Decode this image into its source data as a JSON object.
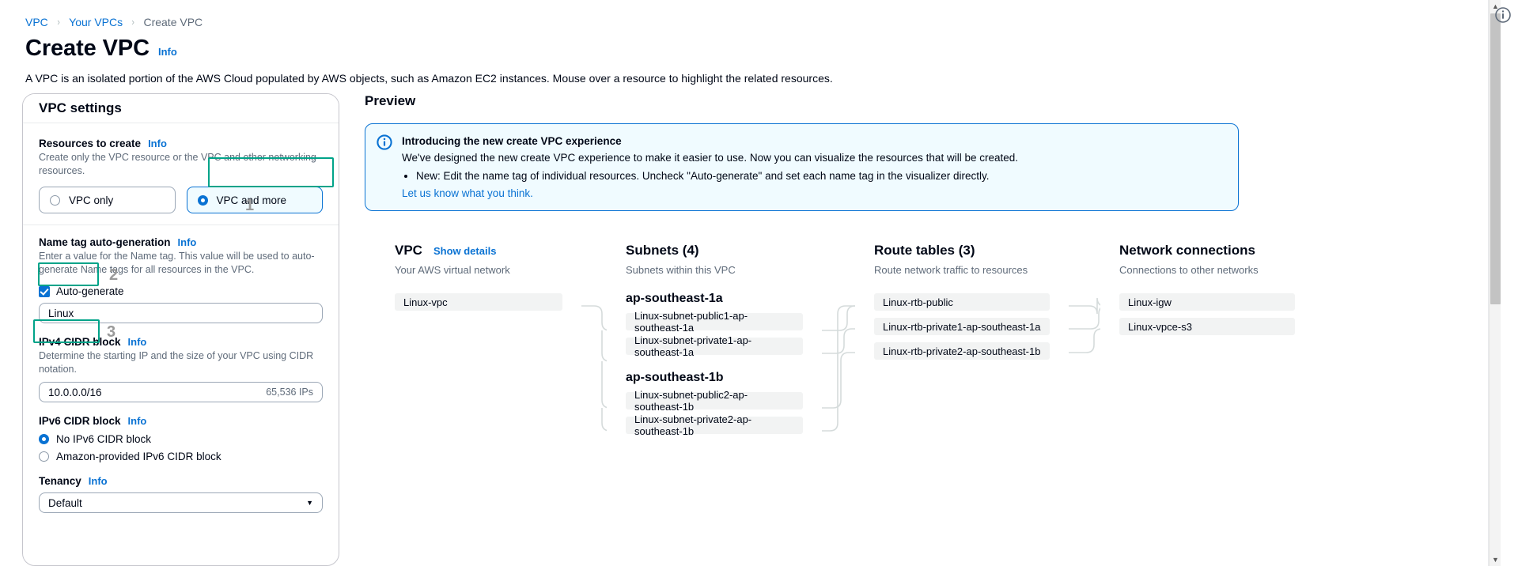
{
  "breadcrumb": {
    "items": [
      "VPC",
      "Your VPCs",
      "Create VPC"
    ],
    "separator": "›"
  },
  "header": {
    "title": "Create VPC",
    "info_label": "Info",
    "description": "A VPC is an isolated portion of the AWS Cloud populated by AWS objects, such as Amazon EC2 instances. Mouse over a resource to highlight the related resources."
  },
  "settings": {
    "card_title": "VPC settings",
    "resources_to_create": {
      "label": "Resources to create",
      "info_label": "Info",
      "description": "Create only the VPC resource or the VPC and other networking resources.",
      "options": [
        "VPC only",
        "VPC and more"
      ],
      "selected": "VPC and more",
      "annotation": "1"
    },
    "name_tag": {
      "label": "Name tag auto-generation",
      "info_label": "Info",
      "description": "Enter a value for the Name tag. This value will be used to auto-generate Name tags for all resources in the VPC.",
      "auto_generate_label": "Auto-generate",
      "auto_generate_checked": true,
      "value": "Linux",
      "annotation": "2"
    },
    "ipv4_cidr": {
      "label": "IPv4 CIDR block",
      "info_label": "Info",
      "description": "Determine the starting IP and the size of your VPC using CIDR notation.",
      "value": "10.0.0.0/16",
      "suffix": "65,536 IPs",
      "annotation": "3"
    },
    "ipv6_cidr": {
      "label": "IPv6 CIDR block",
      "info_label": "Info",
      "options": [
        "No IPv6 CIDR block",
        "Amazon-provided IPv6 CIDR block"
      ],
      "selected": "No IPv6 CIDR block"
    },
    "tenancy": {
      "label": "Tenancy",
      "info_label": "Info",
      "value": "Default",
      "caret": "▼"
    }
  },
  "preview": {
    "title": "Preview",
    "alert": {
      "icon": "info-circle-icon",
      "title": "Introducing the new create VPC experience",
      "body": "We've designed the new create VPC experience to make it easier to use. Now you can visualize the resources that will be created.",
      "bullets": [
        "New: Edit the name tag of individual resources. Uncheck \"Auto-generate\" and set each name tag in the visualizer directly."
      ],
      "link": "Let us know what you think."
    },
    "cards": [
      {
        "title": "VPC",
        "link": "Show details",
        "subtitle": "Your AWS virtual network",
        "items": [
          "Linux-vpc"
        ]
      },
      {
        "title": "Subnets (4)",
        "subtitle": "Subnets within this VPC",
        "groups": [
          {
            "az": "ap-southeast-1a",
            "items": [
              "Linux-subnet-public1-ap-southeast-1a",
              "Linux-subnet-private1-ap-southeast-1a"
            ]
          },
          {
            "az": "ap-southeast-1b",
            "items": [
              "Linux-subnet-public2-ap-southeast-1b",
              "Linux-subnet-private2-ap-southeast-1b"
            ]
          }
        ]
      },
      {
        "title": "Route tables (3)",
        "subtitle": "Route network traffic to resources",
        "items": [
          "Linux-rtb-public",
          "Linux-rtb-private1-ap-southeast-1a",
          "Linux-rtb-private2-ap-southeast-1b"
        ]
      },
      {
        "title": "Network connections",
        "subtitle": "Connections to other networks",
        "items": [
          "Linux-igw",
          "Linux-vpce-s3"
        ]
      }
    ]
  },
  "colors": {
    "accent_blue": "#0972d3",
    "annotation_green": "#00a389",
    "text_primary": "#000716",
    "text_secondary": "#5f6b7a"
  }
}
